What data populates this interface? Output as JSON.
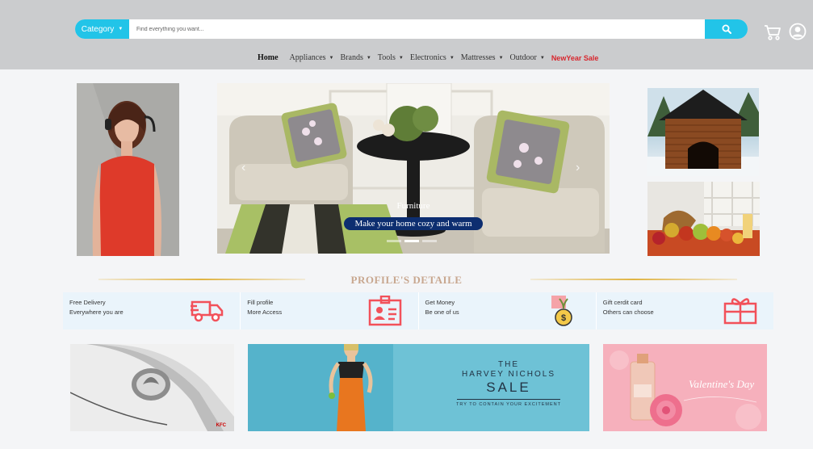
{
  "header": {
    "category_label": "Category",
    "search_placeholder": "Find everything you want..."
  },
  "nav": {
    "items": [
      {
        "label": "Home",
        "has_dropdown": false
      },
      {
        "label": "Appliances",
        "has_dropdown": true
      },
      {
        "label": "Brands",
        "has_dropdown": true
      },
      {
        "label": "Tools",
        "has_dropdown": true
      },
      {
        "label": "Electronics",
        "has_dropdown": true
      },
      {
        "label": "Mattresses",
        "has_dropdown": true
      },
      {
        "label": "Outdoor",
        "has_dropdown": true
      }
    ],
    "sale_label": "NewYear Sale"
  },
  "hero": {
    "title": "Furniture",
    "subtitle": "Make your home cozy and warm"
  },
  "section": {
    "title": "PROFILE'S DETAILE"
  },
  "features": [
    {
      "title": "Free Delivery",
      "subtitle": "Everywhere you are",
      "icon": "truck-icon"
    },
    {
      "title": "Fill profile",
      "subtitle": "More Access",
      "icon": "id-card-icon"
    },
    {
      "title": "Get Money",
      "subtitle": "Be one of us",
      "icon": "coin-medal-icon"
    },
    {
      "title": "Gift cerdit card",
      "subtitle": "Others can choose",
      "icon": "gift-icon"
    }
  ],
  "promos": {
    "harvey": {
      "line1": "THE",
      "line2": "HARVEY NICHOLS",
      "line3": "SALE",
      "line4": "TRY TO CONTAIN YOUR EXCITEMENT"
    },
    "valentine": {
      "text": "Valentine's Day"
    },
    "phone": {
      "brand": "KFC"
    }
  },
  "colors": {
    "accent": "#22c4e8",
    "header_bg": "#cbccce",
    "sale": "#d8262d",
    "feature_icon": "#f2515a",
    "hero_pill": "#0d2e70"
  }
}
